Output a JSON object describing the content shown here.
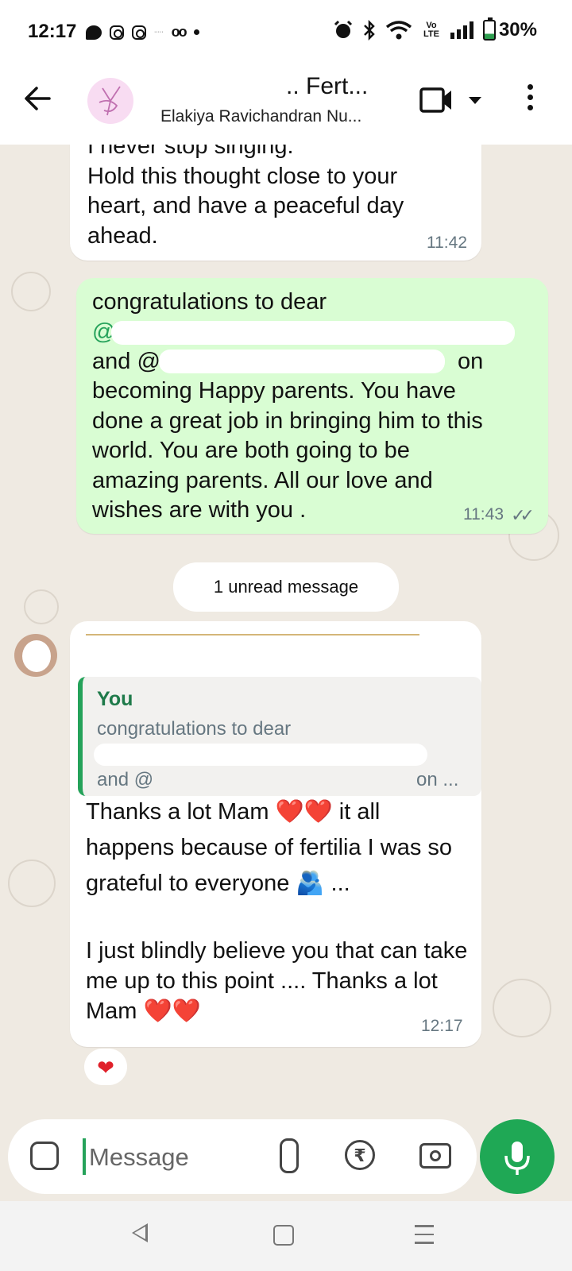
{
  "status_bar": {
    "time": "12:17",
    "network_label": "Vo LTE",
    "battery": "30%",
    "battery_level": 0.3
  },
  "header": {
    "title": ".. Fert...",
    "subtitle": "Elakiya Ravichandran Nu..."
  },
  "messages": {
    "m1": {
      "text": "I never stop singing.\nHold this thought close to your heart, and have a peaceful day ahead.",
      "time": "11:42"
    },
    "m2": {
      "line1": "congratulations to dear",
      "line2_prefix": "@",
      "line3_prefix": "and @",
      "line3_suffix": "on",
      "body": "becoming Happy parents. You have done a great job in bringing him to this world. You are both going to be amazing parents. All our love and wishes are with you .",
      "time": "11:43",
      "ticks": "✓✓"
    },
    "unread_label": "1 unread message",
    "m3": {
      "quote_author": "You",
      "quote_line1": "congratulations to dear",
      "quote_line3_prefix": "and @",
      "quote_line3_suffix": "on ...",
      "text1": "Thanks a lot Mam ❤️❤️ it all happens because of fertilia I was so grateful to everyone 🫂 ...",
      "text2": "I just blindly believe you that can take me up to this point .... Thanks a lot Mam ❤️❤️",
      "time": "12:17",
      "reaction": "❤"
    }
  },
  "input": {
    "placeholder": "Message",
    "rupee": "₹"
  },
  "colors": {
    "outgoing_bubble": "#d9fdd3",
    "chat_background": "#efeae2",
    "accent_green": "#1fa855"
  }
}
